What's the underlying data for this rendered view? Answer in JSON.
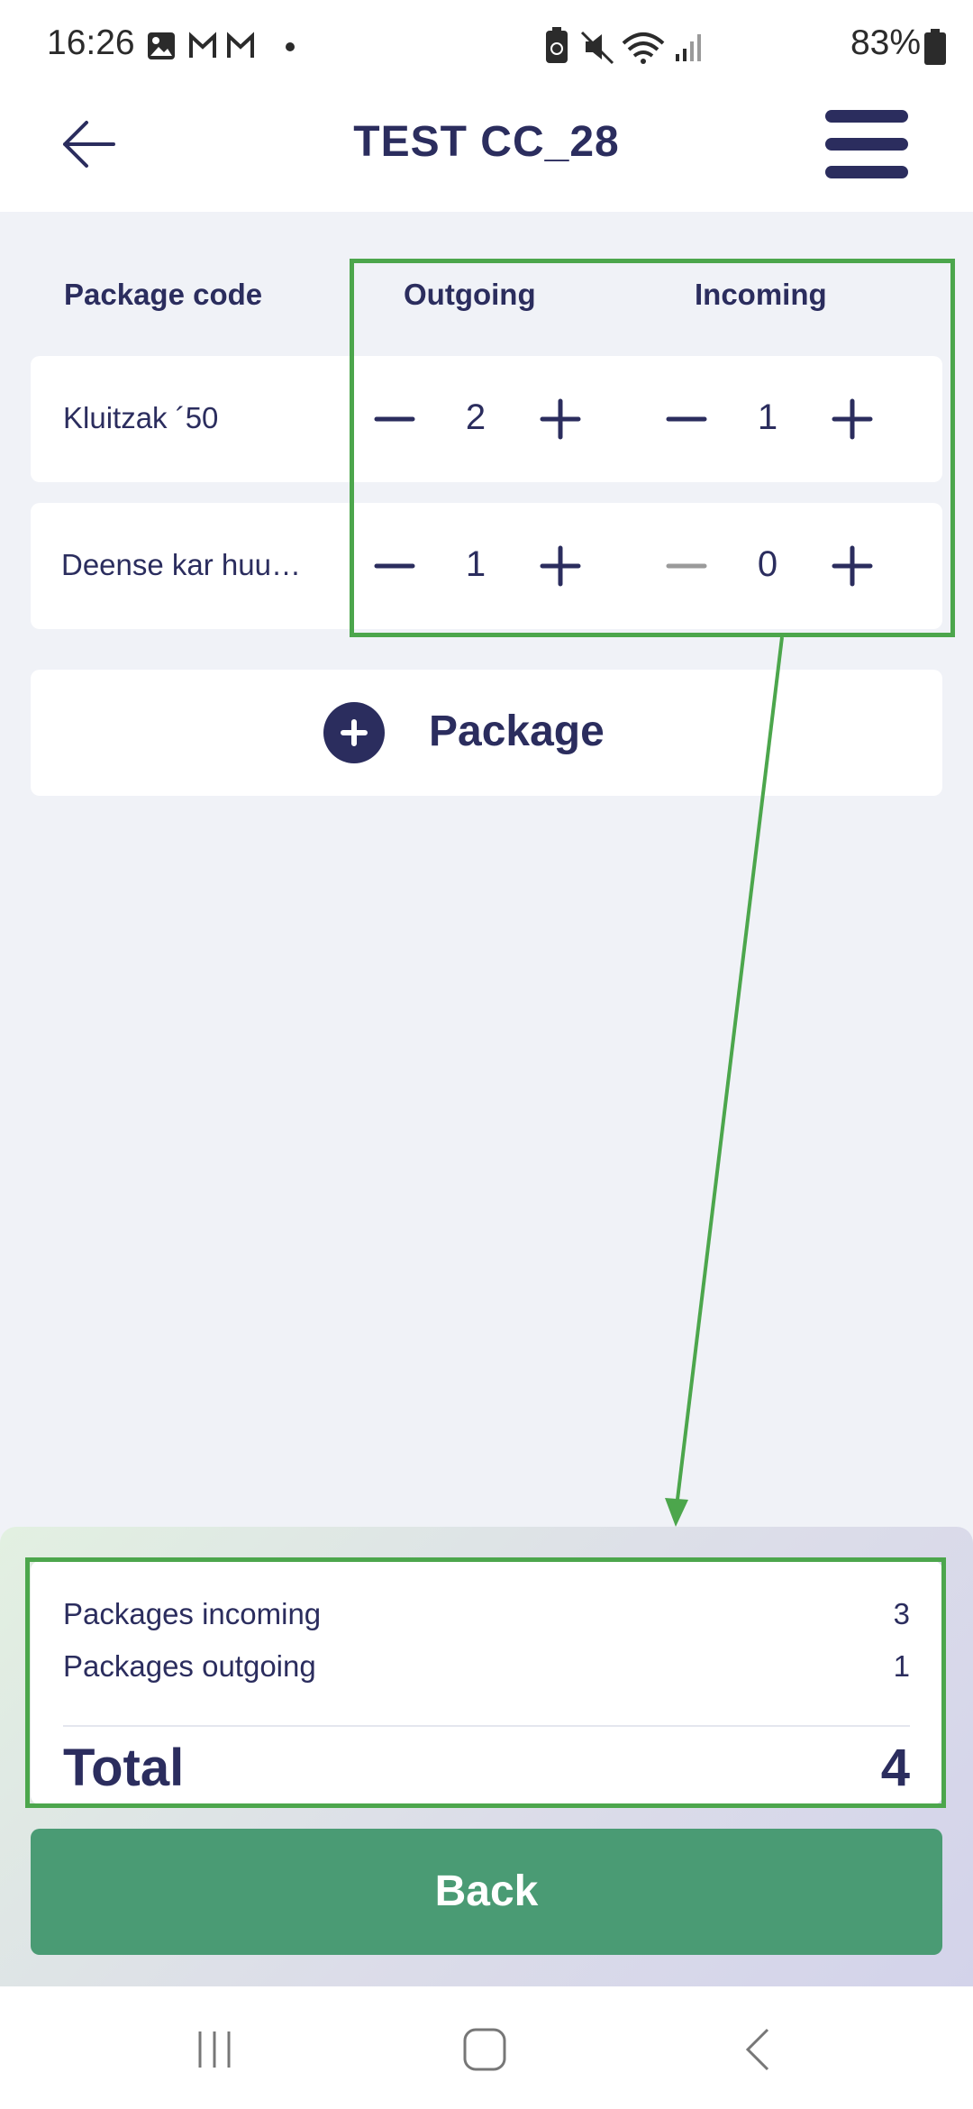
{
  "status_bar": {
    "time": "16:26",
    "battery": "83%",
    "left_icons": [
      "image-icon",
      "gmail-icon",
      "gmail-icon",
      "dot-icon"
    ],
    "right_icons": [
      "battery-saver-icon",
      "mute-icon",
      "wifi-icon",
      "signal-icon",
      "battery-icon"
    ]
  },
  "header": {
    "title": "TEST CC_28"
  },
  "table": {
    "headers": {
      "code": "Package code",
      "outgoing": "Outgoing",
      "incoming": "Incoming"
    },
    "rows": [
      {
        "label": "Kluitzak ´50",
        "outgoing": "2",
        "incoming": "1",
        "incoming_minus_disabled": false
      },
      {
        "label": "Deense kar huu…",
        "outgoing": "1",
        "incoming": "0",
        "incoming_minus_disabled": true
      }
    ]
  },
  "add_package": {
    "label": "Package"
  },
  "summary": {
    "incoming_label": "Packages incoming",
    "incoming_value": "3",
    "outgoing_label": "Packages outgoing",
    "outgoing_value": "1",
    "total_label": "Total",
    "total_value": "4"
  },
  "back_button": {
    "label": "Back"
  },
  "colors": {
    "primary": "#2b2d5e",
    "success": "#4a9b74",
    "annotation": "#4ca64c",
    "background": "#f0f2f7",
    "disabled": "#9a9a9a"
  }
}
